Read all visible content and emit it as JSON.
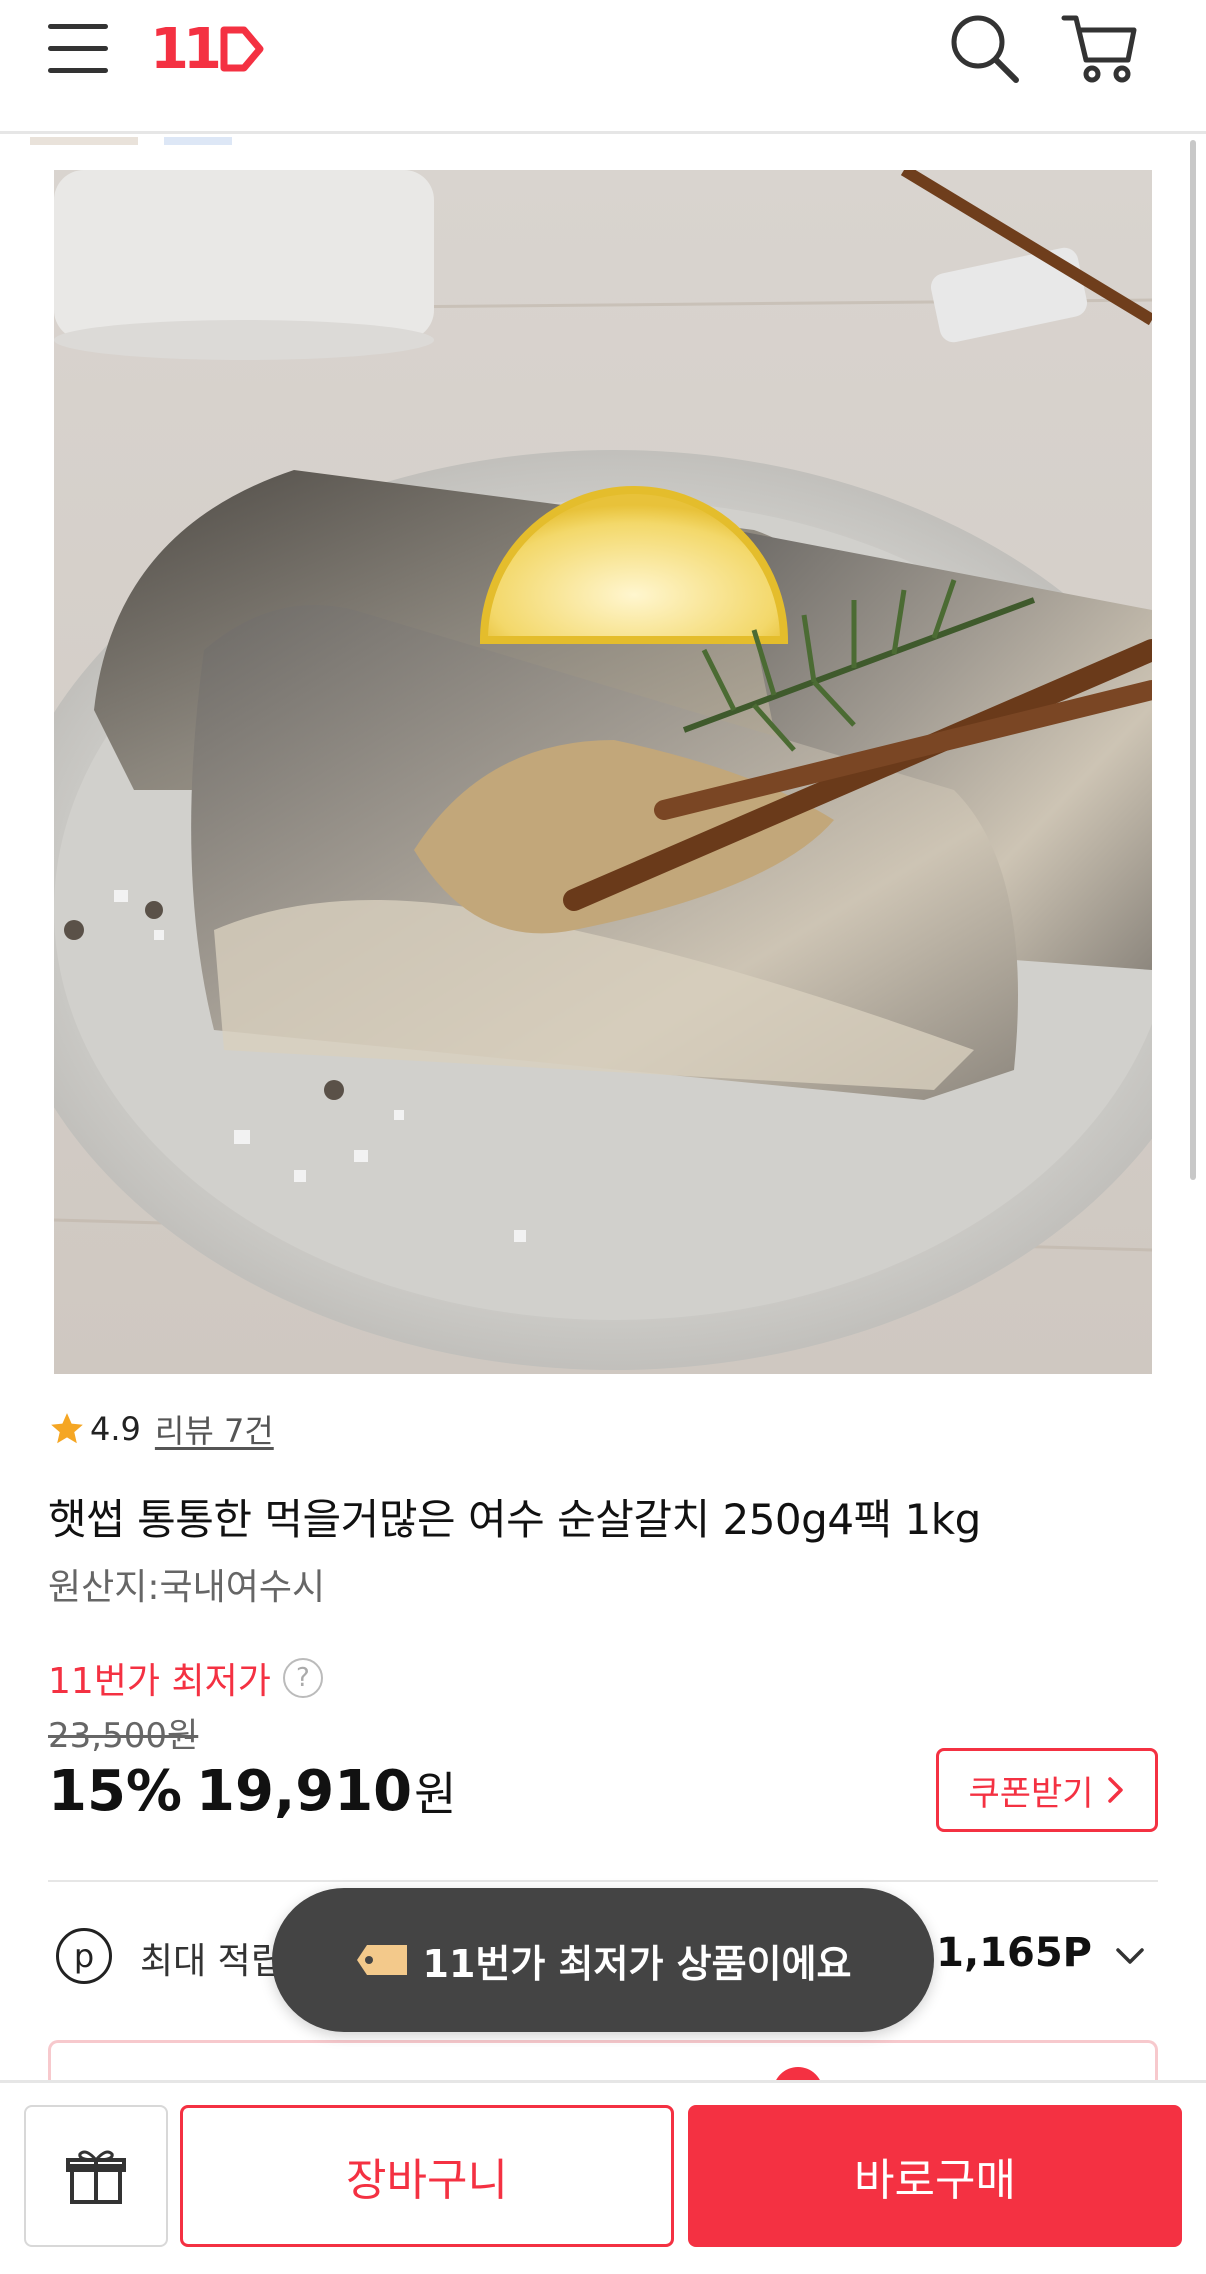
{
  "header": {
    "logo_text": "11",
    "brand_color": "#f43142",
    "icons": [
      "menu-icon",
      "search-icon",
      "cart-icon"
    ]
  },
  "product": {
    "image_alt": "product-photo",
    "rating": "4.9",
    "review_link": "리뷰 7건",
    "title": "햇썹 통통한 먹을거많은 여수 순살갈치 250g4팩 1kg",
    "origin": "원산지:국내여수시"
  },
  "pricing": {
    "lowest_label": "11번가 최저가",
    "help_symbol": "?",
    "original_price": "23,500원",
    "discount": "15%",
    "price": "19,910",
    "currency": "원",
    "coupon_label": "쿠폰받기"
  },
  "points": {
    "icon_letter": "p",
    "label": "최대 적립",
    "value": "1,165P"
  },
  "toast": {
    "message": "11번가 최저가 상품이에요"
  },
  "bottom_bar": {
    "cart_label": "장바구니",
    "buy_label": "바로구매"
  }
}
